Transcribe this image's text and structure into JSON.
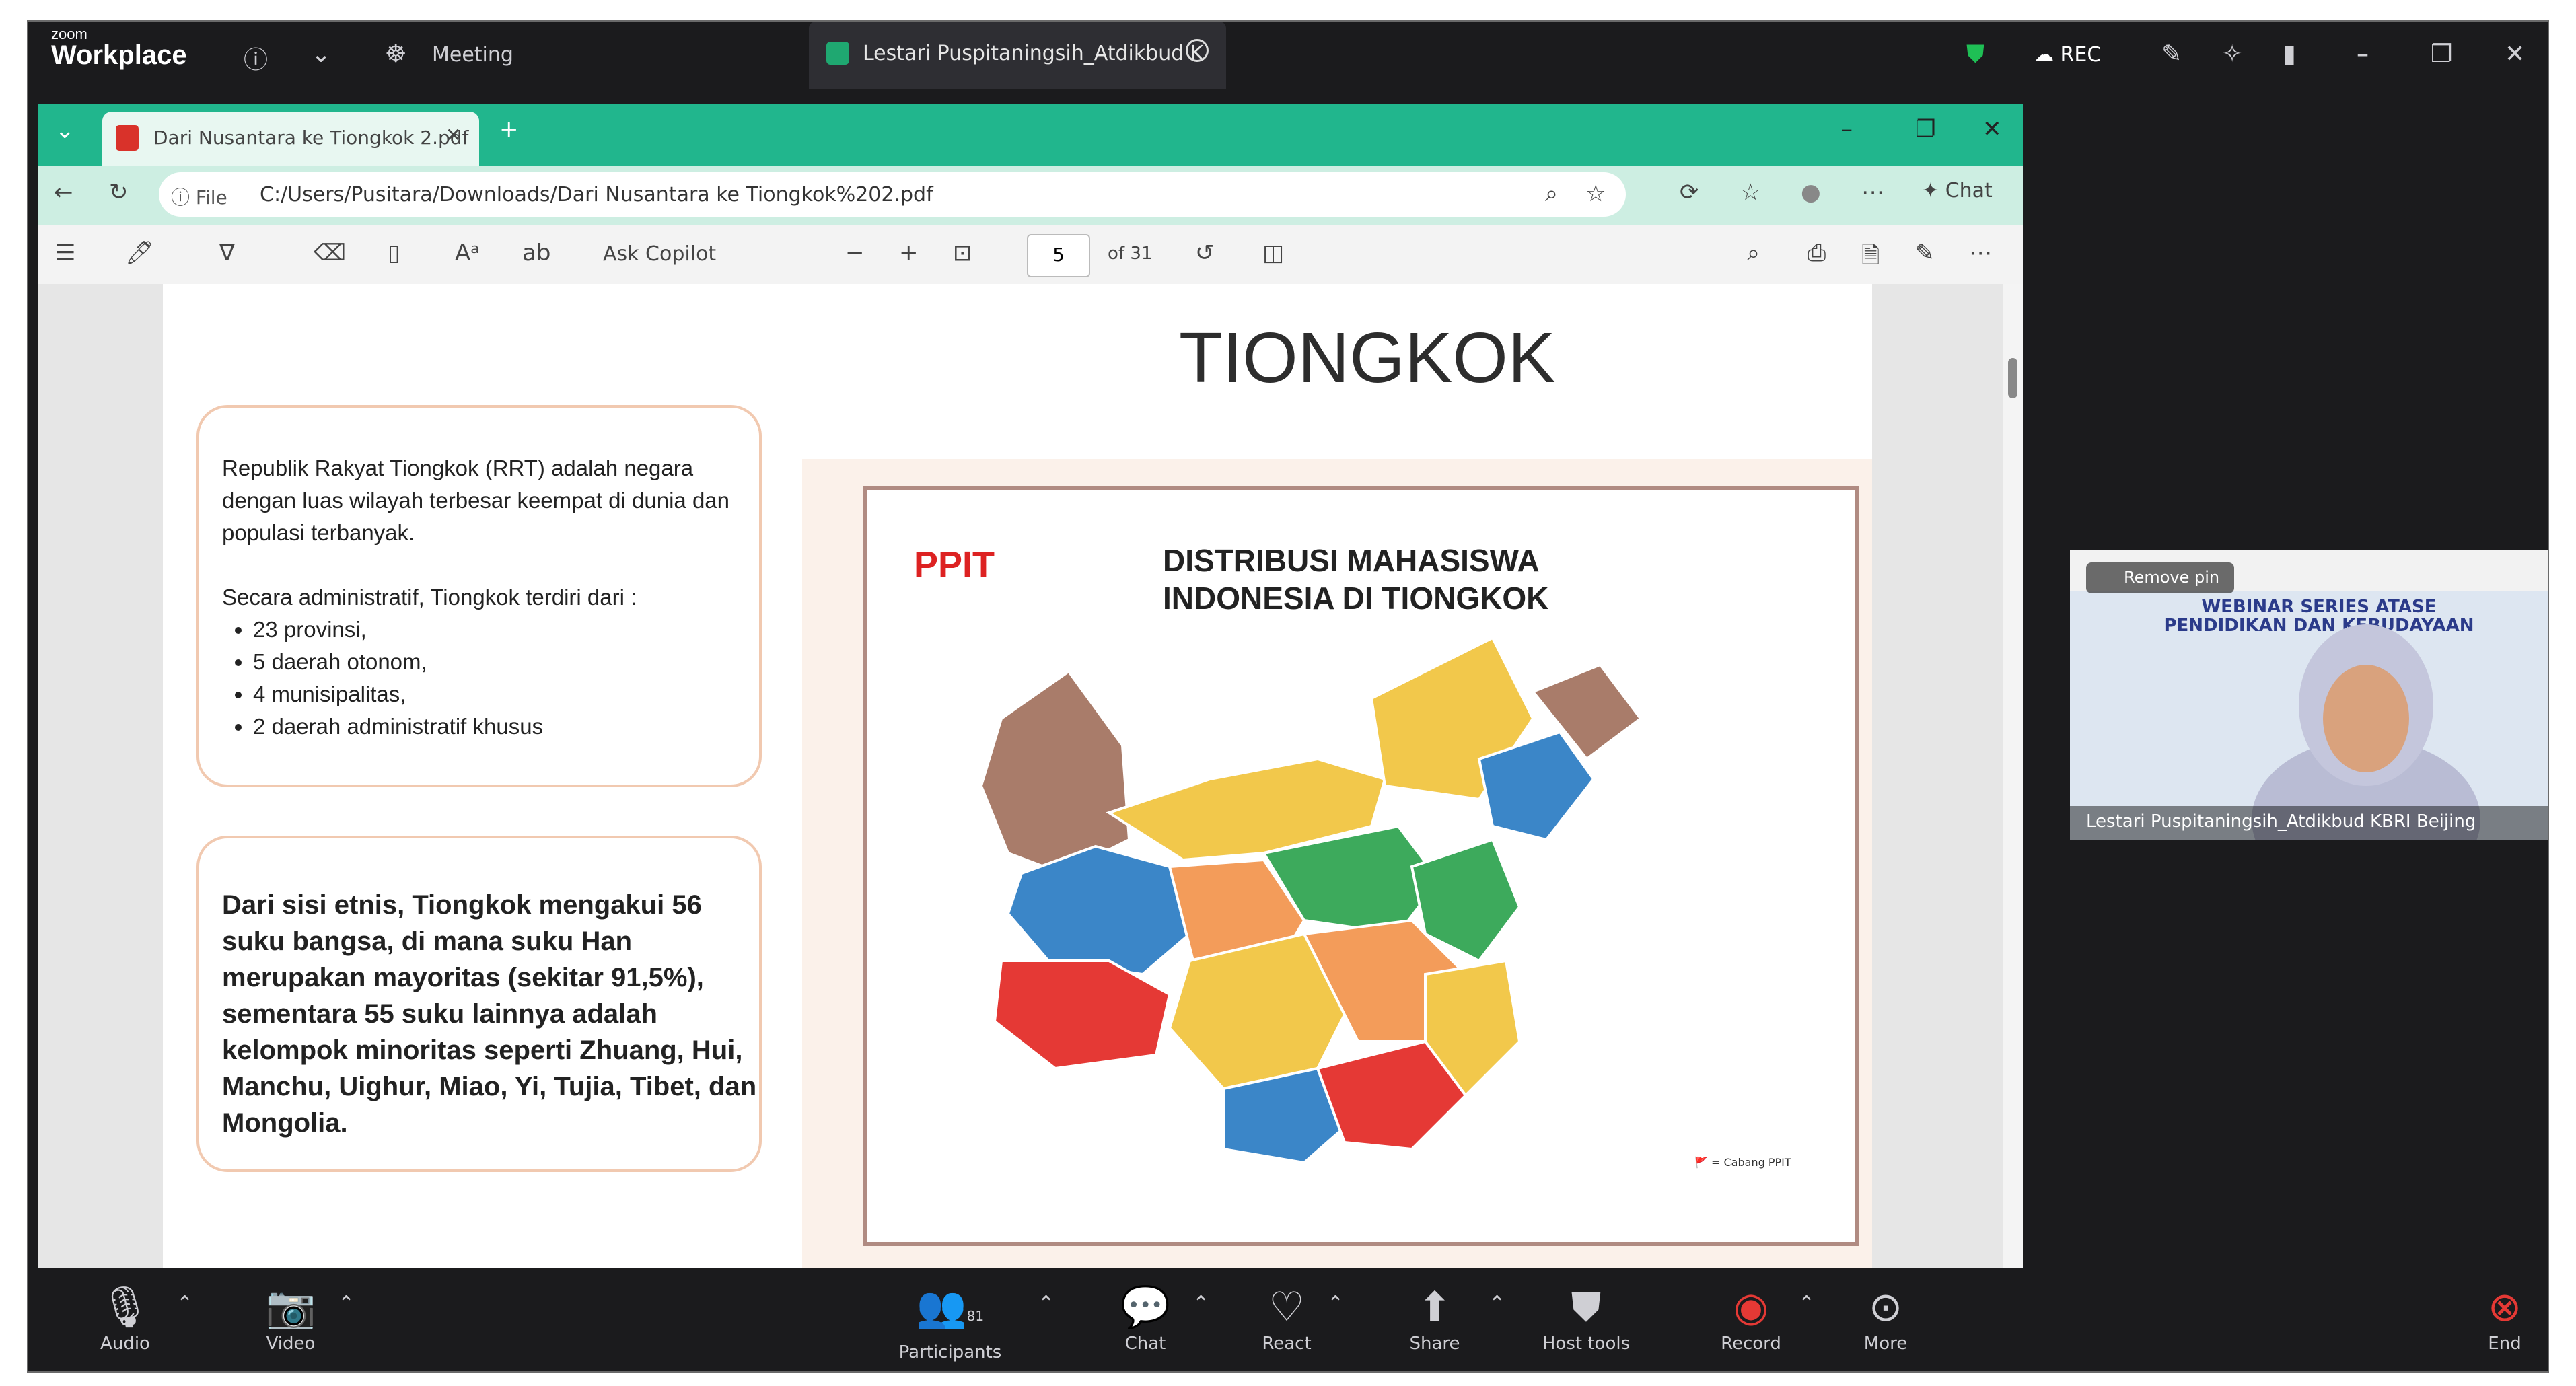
{
  "zoom": {
    "brand_small": "zoom",
    "brand": "Workplace",
    "meeting_label": "Meeting",
    "share_tab": "Lestari Puspitaningsih_Atdikbud K",
    "rec_label": "REC"
  },
  "browser": {
    "tab_title": "Dari Nusantara ke Tiongkok 2.pdf",
    "url_prefix": "File",
    "url": "C:/Users/Pusitara/Downloads/Dari Nusantara ke Tiongkok%202.pdf",
    "copilot_label": "Chat",
    "ask_copilot": "Ask Copilot",
    "page_number": "5",
    "page_total": "of 31"
  },
  "slide": {
    "title": "TIONGKOK",
    "card1_intro": "Republik Rakyat Tiongkok (RRT) adalah negara dengan luas wilayah terbesar keempat di dunia dan populasi terbanyak.",
    "card1_admin": "Secara administratif, Tiongkok terdiri dari :",
    "card1_items": [
      "23 provinsi,",
      "5 daerah otonom,",
      "4 munisipalitas,",
      "2 daerah administratif khusus"
    ],
    "card2_text": "Dari sisi etnis, Tiongkok mengakui 56 suku bangsa, di mana suku Han merupakan mayoritas (sekitar 91,5%), sementara 55 suku lainnya adalah kelompok minoritas seperti Zhuang, Hui, Manchu, Uighur, Miao, Yi, Tujia, Tibet, dan Mongolia.",
    "map_title_1": "DISTRIBUSI MAHASISWA",
    "map_title_2": "INDONESIA DI TIONGKOK",
    "map_logo": "PPIT",
    "legend": "= Cabang PPIT"
  },
  "participant": {
    "remove_pin": "Remove pin",
    "banner": "WEBINAR SERIES ATASE PENDIDIKAN DAN KEBUDAYAAN",
    "name": "Lestari Puspitaningsih_Atdikbud KBRI Beijing"
  },
  "controls": {
    "audio": "Audio",
    "video": "Video",
    "participants": "Participants",
    "participants_count": "81",
    "chat": "Chat",
    "react": "React",
    "share": "Share",
    "host_tools": "Host tools",
    "record": "Record",
    "more": "More",
    "end": "End"
  }
}
